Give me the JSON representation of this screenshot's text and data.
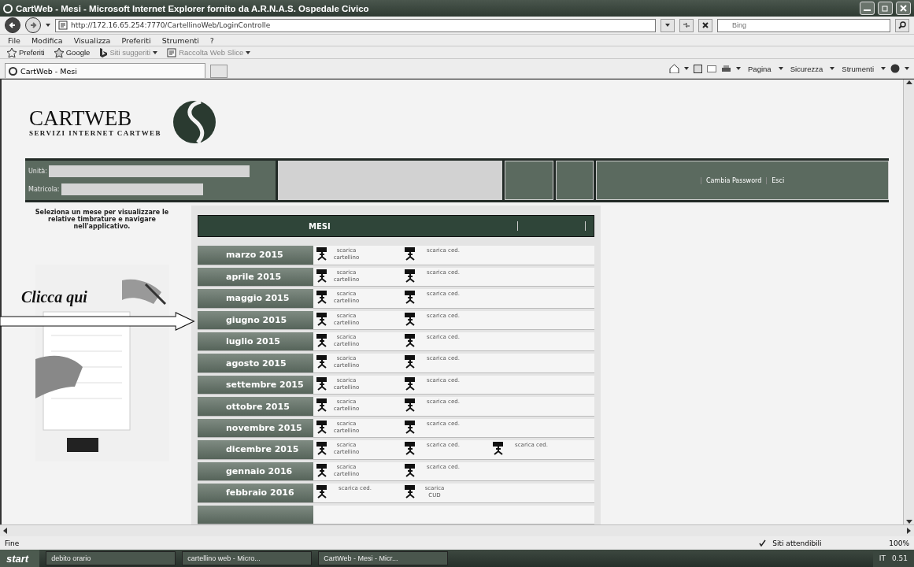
{
  "window": {
    "title": "CartWeb - Mesi - Microsoft Internet Explorer fornito da A.R.N.A.S. Ospedale Civico"
  },
  "address_bar": {
    "url": "http://172.16.65.254:7770/CartellinoWeb/LoginControlle",
    "search_placeholder": "Bing"
  },
  "menu": [
    "File",
    "Modifica",
    "Visualizza",
    "Preferiti",
    "Strumenti",
    "?"
  ],
  "favorites_bar": [
    {
      "label": "Preferiti",
      "kind": "star"
    },
    {
      "label": "Google",
      "kind": "google"
    },
    {
      "label": "Siti suggeriti",
      "kind": "bing"
    },
    {
      "label": "Raccolta Web Slice",
      "kind": "page"
    }
  ],
  "tab": {
    "title": "CartWeb - Mesi"
  },
  "command_bar": [
    "Pagina",
    "Sicurezza",
    "Strumenti"
  ],
  "site": {
    "brand": "CARTWEB",
    "subtitle": "SERVIZI INTERNET CARTWEB",
    "info_fields": [
      {
        "label": "Unità:"
      },
      {
        "label": "Matricola:"
      }
    ],
    "header_links": [
      "Cambia Password",
      "Esci"
    ],
    "instructions": "Seleziona un mese per visualizzare le relative timbrature e navigare nell'applicativo.",
    "annotation": "Clicca qui",
    "table_header": "MESI",
    "months": [
      {
        "label": "marzo 2015",
        "links": [
          "scarica cartellino",
          "scarica ced."
        ]
      },
      {
        "label": "aprile 2015",
        "links": [
          "scarica cartellino",
          "scarica ced."
        ]
      },
      {
        "label": "maggio 2015",
        "links": [
          "scarica cartellino",
          "scarica ced."
        ]
      },
      {
        "label": "giugno 2015",
        "links": [
          "scarica cartellino",
          "scarica ced."
        ]
      },
      {
        "label": "luglio 2015",
        "links": [
          "scarica cartellino",
          "scarica ced."
        ]
      },
      {
        "label": "agosto 2015",
        "links": [
          "scarica cartellino",
          "scarica ced."
        ]
      },
      {
        "label": "settembre 2015",
        "links": [
          "scarica cartellino",
          "scarica ced."
        ]
      },
      {
        "label": "ottobre 2015",
        "links": [
          "scarica cartellino",
          "scarica ced."
        ]
      },
      {
        "label": "novembre 2015",
        "links": [
          "scarica cartellino",
          "scarica ced."
        ]
      },
      {
        "label": "dicembre 2015",
        "links": [
          "scarica cartellino",
          "scarica ced.",
          "scarica ced."
        ]
      },
      {
        "label": "gennaio 2016",
        "links": [
          "scarica cartellino",
          "scarica ced."
        ]
      },
      {
        "label": "febbraio 2016",
        "links": [
          "scarica ced.",
          "scarica CUD"
        ]
      }
    ]
  },
  "status_bar": {
    "text": "Fine",
    "zone": "Siti attendibili",
    "zoom": "100%"
  },
  "taskbar": {
    "start": "start",
    "items": [
      "debito orario",
      "cartellino web - Micro...",
      "CartWeb - Mesi - Micr..."
    ],
    "language": "IT",
    "clock": "0.51"
  }
}
